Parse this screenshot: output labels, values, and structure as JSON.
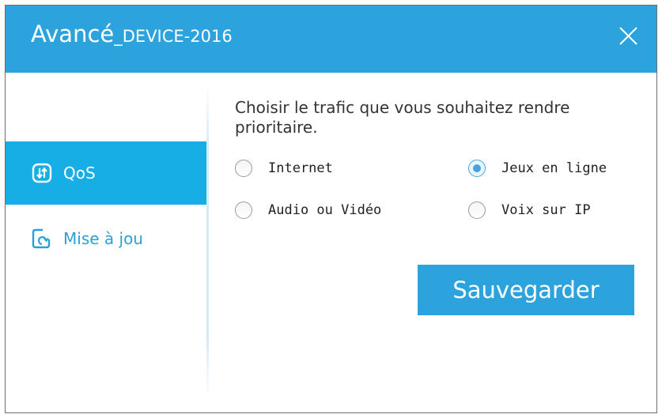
{
  "window": {
    "title_main": "Avancé",
    "title_device": "_DEVICE-2016",
    "close_icon": "close-icon"
  },
  "colors": {
    "accent": "#2da3dd",
    "sidebar_active": "#17aee6",
    "sidebar_inactive_text": "#2a9fd8",
    "radio_checked": "#4aa2d9"
  },
  "sidebar": {
    "items": [
      {
        "label": "QoS",
        "icon": "qos-arrows-icon",
        "active": true
      },
      {
        "label": "Mise à jou",
        "icon": "update-icon",
        "active": false
      }
    ]
  },
  "qos": {
    "prompt": "Choisir le trafic que vous souhaitez rendre prioritaire.",
    "options": [
      {
        "label": "Internet",
        "checked": false
      },
      {
        "label": "Jeux en ligne",
        "checked": true
      },
      {
        "label": "Audio ou Vidéo",
        "checked": false
      },
      {
        "label": "Voix sur IP",
        "checked": false
      }
    ],
    "save_label": "Sauvegarder"
  }
}
